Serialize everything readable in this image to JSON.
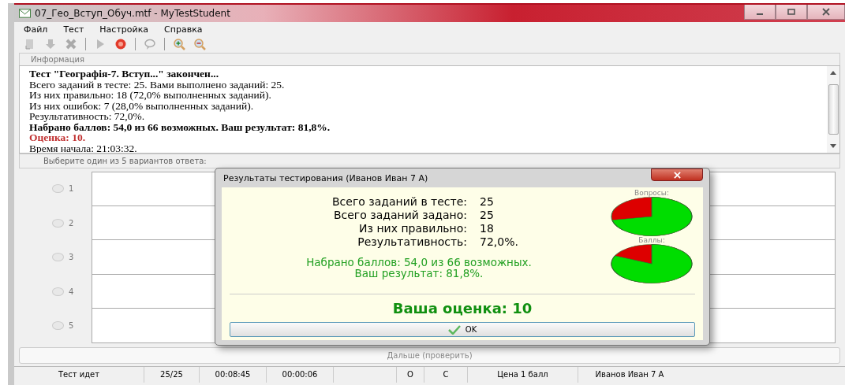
{
  "window": {
    "title": "07_Гео_Вступ_Обуч.mtf - MyTestStudent"
  },
  "menu": [
    "Файл",
    "Тест",
    "Настройка",
    "Справка"
  ],
  "info": {
    "header": "Информация",
    "lines": [
      {
        "kind": "bold",
        "text": "Тест \"Географія-7. Вступ...\" закончен..."
      },
      {
        "kind": "plain",
        "text": "Всего заданий в тесте: 25. Вами выполнено заданий: 25."
      },
      {
        "kind": "plain",
        "text": "Из них правильно: 18 (72,0% выполненных заданий)."
      },
      {
        "kind": "plain",
        "text": "Из них ошибок: 7 (28,0% выполненных заданий)."
      },
      {
        "kind": "plain",
        "text": "Результативность: 72,0%."
      },
      {
        "kind": "bold",
        "text": "Набрано баллов: 54,0 из 66 возможных. Ваш результат: 81,8%."
      },
      {
        "kind": "grade",
        "text": "Оценка: 10."
      },
      {
        "kind": "plain",
        "text": "Время начала: 21:03:32."
      }
    ]
  },
  "answers": {
    "prompt": "Выберите один из 5 вариантов ответа:",
    "options": [
      {
        "label": "1",
        "selected": false
      },
      {
        "label": "2",
        "selected": false
      },
      {
        "label": "3",
        "selected": false
      },
      {
        "label": "4",
        "selected": false
      },
      {
        "label": "5",
        "selected": false
      }
    ]
  },
  "next_button": "Дальше (проверить)",
  "dialog": {
    "title": "Результаты тестирования (Иванов Иван 7 А)",
    "stats": [
      {
        "label": "Всего заданий в тесте:",
        "value": "25"
      },
      {
        "label": "Всего заданий задано:",
        "value": "25"
      },
      {
        "label": "Из них правильно:",
        "value": "18"
      },
      {
        "label": "Результативность:",
        "value": "72,0%."
      }
    ],
    "score_lines": [
      "Набрано баллов: 54,0 из 66 возможных.",
      "Ваш результат: 81,8%."
    ],
    "pies": [
      {
        "label": "Вопросы:"
      },
      {
        "label": "Баллы:"
      }
    ],
    "grade": "Ваша оценка: 10",
    "ok_button": "OK"
  },
  "status_bar": [
    "Тест идет",
    "25/25",
    "00:08:45",
    "00:00:06",
    "О",
    "С",
    "Цена 1 балл",
    "Иванов Иван 7 А"
  ]
}
